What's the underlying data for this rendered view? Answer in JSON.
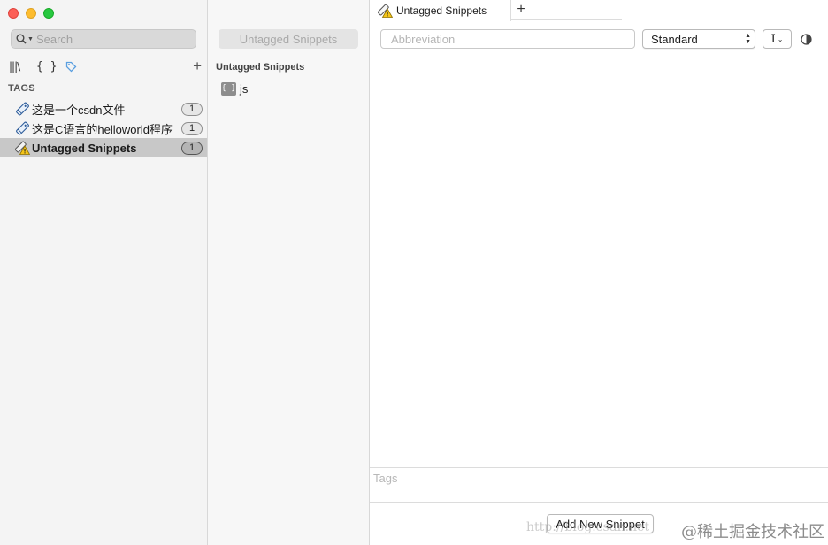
{
  "window": {
    "traffic_lights": [
      "close",
      "minimize",
      "zoom"
    ]
  },
  "sidebar": {
    "search": {
      "placeholder": "Search",
      "value": ""
    },
    "modes": [
      "library-icon",
      "braces-icon",
      "tag-icon"
    ],
    "add_label": "+",
    "tags_header": "TAGS",
    "tags": [
      {
        "label": "这是一个csdn文件",
        "count": "1",
        "icon": "tag-icon",
        "selected": false
      },
      {
        "label": "这是C语言的helloworld程序",
        "count": "1",
        "icon": "tag-icon",
        "selected": false
      },
      {
        "label": "Untagged Snippets",
        "count": "1",
        "icon": "untagged-warning-icon",
        "selected": true
      }
    ]
  },
  "middle": {
    "title": "Untagged Snippets",
    "heading": "Untagged Snippets",
    "snippets": [
      {
        "label": "js",
        "icon": "snippet-code-icon",
        "icon_text": "{ }"
      }
    ]
  },
  "editor": {
    "tab": {
      "label": "Untagged Snippets",
      "icon": "untagged-warning-icon"
    },
    "new_tab_label": "+",
    "abbreviation": {
      "placeholder": "Abbreviation",
      "value": ""
    },
    "mode_select": {
      "value": "Standard"
    },
    "cursor_glyph": "I",
    "tags_placeholder": "Tags",
    "add_button": "Add New Snippet"
  },
  "watermark": {
    "text": "@稀土掘金技术社区",
    "url_text": "http://blog.csdn.net"
  },
  "colors": {
    "close": "#fc5f57",
    "minimize": "#fdbc2e",
    "zoom": "#28c840",
    "tag_accent": "#5a9fe0",
    "selected_row": "#c8c8c8"
  }
}
